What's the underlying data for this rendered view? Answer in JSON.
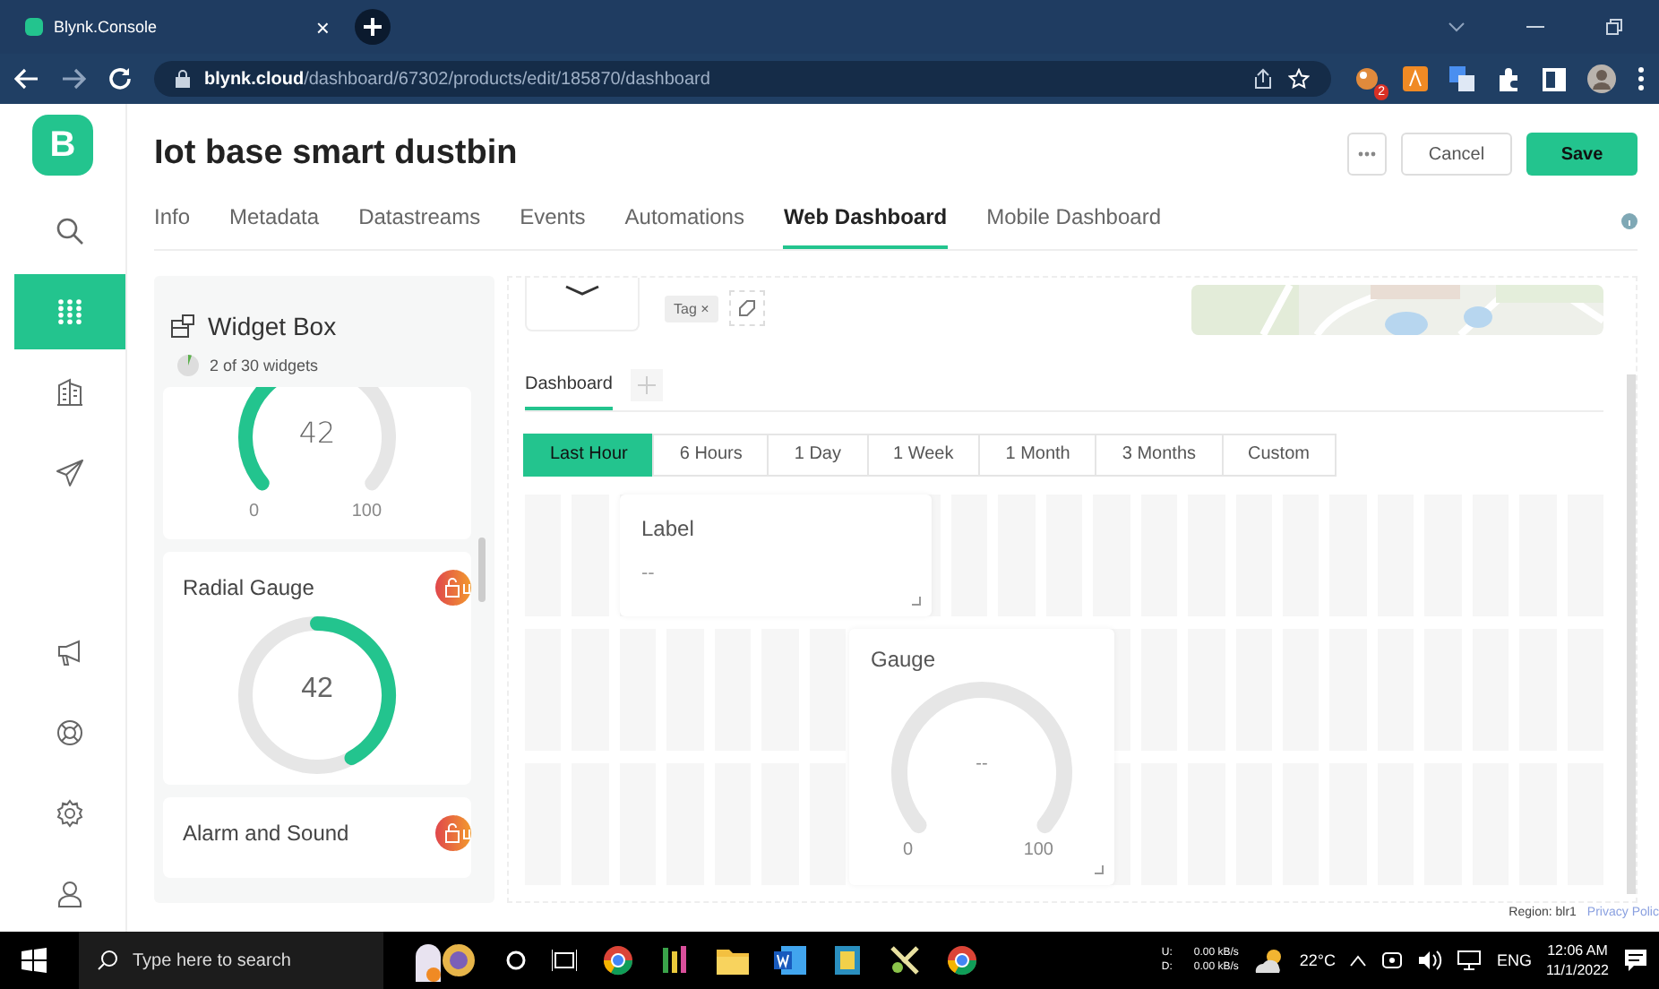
{
  "browser": {
    "tab_title": "Blynk.Console",
    "tab_close": "×",
    "url_host": "blynk.cloud",
    "url_path": "/dashboard/67302/products/edit/185870/dashboard",
    "extension_badge": "2"
  },
  "sidebar": {
    "logo": "B",
    "items": [
      {
        "kind": "search",
        "selected": false
      },
      {
        "kind": "grid",
        "selected": true
      },
      {
        "kind": "building",
        "selected": false
      },
      {
        "kind": "send",
        "selected": false
      },
      {
        "kind": "megaphone",
        "selected": false
      },
      {
        "kind": "lifebuoy",
        "selected": false
      },
      {
        "kind": "gear",
        "selected": false
      },
      {
        "kind": "user",
        "selected": false
      }
    ]
  },
  "header": {
    "title": "Iot base smart dustbin",
    "cancel": "Cancel",
    "save": "Save"
  },
  "tabs": [
    {
      "label": "Info",
      "selected": false
    },
    {
      "label": "Metadata",
      "selected": false
    },
    {
      "label": "Datastreams",
      "selected": false
    },
    {
      "label": "Events",
      "selected": false
    },
    {
      "label": "Automations",
      "selected": false
    },
    {
      "label": "Web Dashboard",
      "selected": true
    },
    {
      "label": "Mobile Dashboard",
      "selected": false
    }
  ],
  "widget_box": {
    "title": "Widget Box",
    "count": "2 of 30 widgets",
    "widgets": [
      {
        "kind": "gauge",
        "value": "42",
        "min": "0",
        "max": "100",
        "locked": false
      },
      {
        "kind": "radial",
        "title": "Radial Gauge",
        "value": "42",
        "locked": true
      },
      {
        "kind": "plain",
        "title": "Alarm and Sound",
        "locked": true
      }
    ]
  },
  "dashboard": {
    "tag": "Tag",
    "tag_remove": "×",
    "tab": "Dashboard",
    "time_ranges": [
      {
        "label": "Last Hour",
        "selected": true
      },
      {
        "label": "6 Hours",
        "selected": false
      },
      {
        "label": "1 Day",
        "selected": false
      },
      {
        "label": "1 Week",
        "selected": false
      },
      {
        "label": "1 Month",
        "selected": false
      },
      {
        "label": "3 Months",
        "selected": false
      },
      {
        "label": "Custom",
        "selected": false
      }
    ],
    "widgets": [
      {
        "kind": "label",
        "title": "Label",
        "value": "--"
      },
      {
        "kind": "gauge",
        "title": "Gauge",
        "value": "--",
        "min": "0",
        "max": "100"
      }
    ]
  },
  "footer": {
    "region": "Region: blr1",
    "privacy": "Privacy Polic"
  },
  "taskbar": {
    "search_placeholder": "Type here to search",
    "up_label": "U:",
    "down_label": "D:",
    "up_rate": "0.00 kB/s",
    "down_rate": "0.00 kB/s",
    "temperature": "22°C",
    "language": "ENG",
    "time": "12:06 AM",
    "date": "11/1/2022"
  }
}
